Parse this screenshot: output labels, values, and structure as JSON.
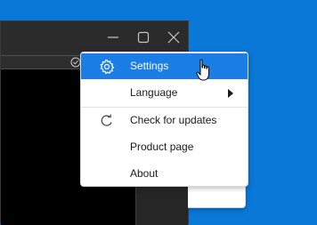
{
  "colors": {
    "desktop": "#0a78d7",
    "highlight": "#1a7ee6",
    "window_bg": "#2b2b2b",
    "menu_bg": "#ffffff"
  },
  "window_controls": {
    "menu_icon": "kebab-vertical-icon",
    "minimize_icon": "minimize-icon",
    "maximize_icon": "maximize-icon",
    "close_icon": "close-icon"
  },
  "menu": {
    "items": [
      {
        "label": "Settings",
        "icon": "gear-icon",
        "highlighted": true
      },
      {
        "label": "Language",
        "submenu": true
      },
      {
        "label": "Check for updates",
        "icon": "refresh-icon"
      },
      {
        "label": "Product page"
      },
      {
        "label": "About"
      }
    ]
  }
}
